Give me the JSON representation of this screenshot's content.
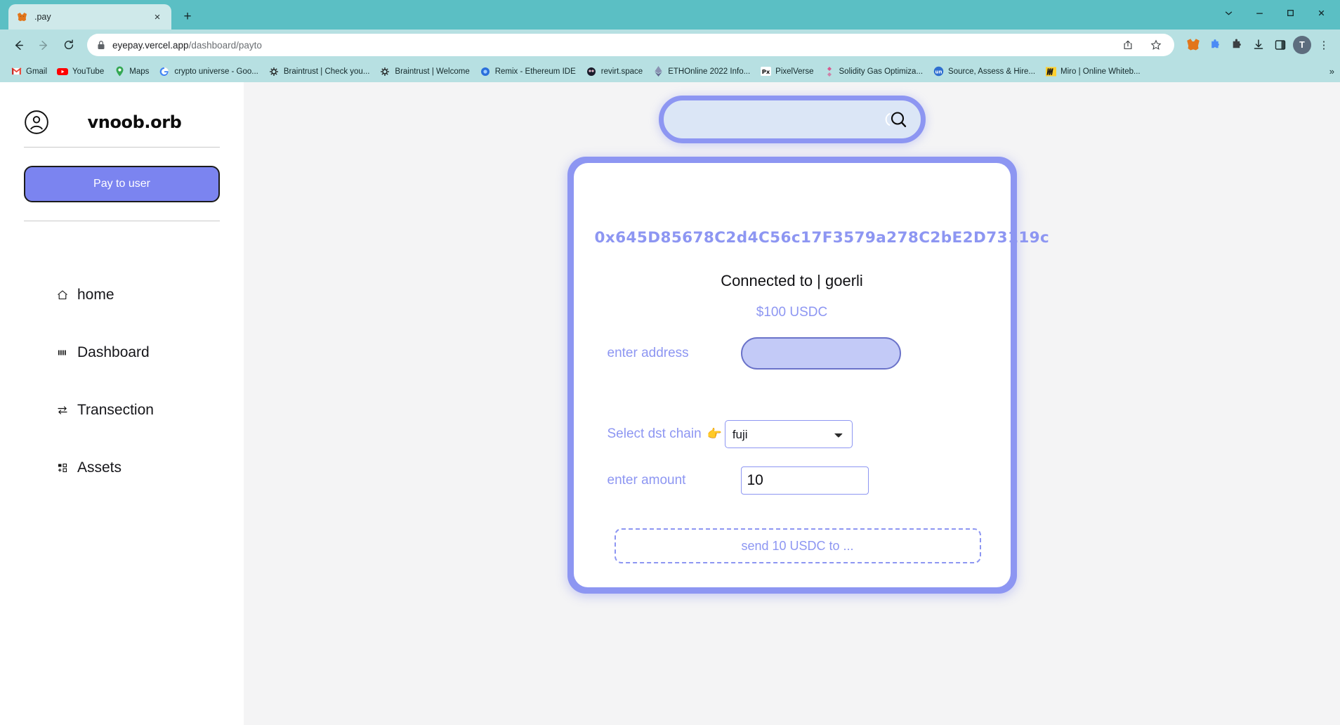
{
  "browser": {
    "tab": {
      "title": ".pay",
      "favicon": "metamask-fox-icon",
      "close": "×"
    },
    "new_tab": "+",
    "window_controls": {
      "minimize": "⌄",
      "restore": "─",
      "maximize": "□",
      "close": "✕"
    },
    "nav": {
      "back": "←",
      "forward": "→",
      "reload": "↻"
    },
    "omnibox": {
      "lock": "lock-icon",
      "url_host": "eyepay.vercel.app",
      "url_path": "/dashboard/payto",
      "url_full": "eyepay.vercel.app/dashboard/payto",
      "share": "share-icon",
      "bookmark_star": "☆"
    },
    "extensions": [
      "metamask-icon",
      "puzzle-piece-icon",
      "extensions-icon",
      "download-icon",
      "sidepanel-icon"
    ],
    "profile_initial": "T",
    "menu": "⋮",
    "bookmarks": [
      {
        "label": "Gmail",
        "icon": "gmail-icon"
      },
      {
        "label": "YouTube",
        "icon": "youtube-icon"
      },
      {
        "label": "Maps",
        "icon": "maps-icon"
      },
      {
        "label": "crypto universe - Goo...",
        "icon": "google-icon"
      },
      {
        "label": "Braintrust | Check you...",
        "icon": "braintrust-icon"
      },
      {
        "label": "Braintrust | Welcome",
        "icon": "braintrust-icon"
      },
      {
        "label": "Remix - Ethereum IDE",
        "icon": "remix-icon"
      },
      {
        "label": "revirt.space",
        "icon": "revirt-icon"
      },
      {
        "label": "ETHOnline 2022 Info...",
        "icon": "ethereum-icon"
      },
      {
        "label": "PixelVerse",
        "icon": "pixelverse-icon"
      },
      {
        "label": "Solidity Gas Optimiza...",
        "icon": "solidity-icon"
      },
      {
        "label": "Source, Assess & Hire...",
        "icon": "unstop-icon"
      },
      {
        "label": "Miro | Online Whiteb...",
        "icon": "miro-icon"
      }
    ],
    "bookmarks_overflow": "»"
  },
  "sidebar": {
    "avatar_icon": "user-circle-icon",
    "brand": "vnoob.orb",
    "pay_button": "Pay to user",
    "items": [
      {
        "label": "home",
        "icon": "home-icon",
        "glyph": "⌂"
      },
      {
        "label": "Dashboard",
        "icon": "dashboard-icon",
        "glyph": "▐▐"
      },
      {
        "label": "Transection",
        "icon": "transfer-icon",
        "glyph": "⇄"
      },
      {
        "label": "Assets",
        "icon": "assets-grid-icon",
        "glyph": "⊞"
      }
    ]
  },
  "main": {
    "search": {
      "value": "",
      "placeholder": "",
      "icon": "search-icon"
    },
    "card": {
      "wallet_address": "0x645D85678C2d4C56c17F3579a278C2bE2D73119c",
      "connected_text": "Connected to | goerli",
      "balance": "$100 USDC",
      "address_field": {
        "label": "enter address",
        "value": "",
        "placeholder": ""
      },
      "chain_field": {
        "label": "Select dst chain",
        "emoji": "👉",
        "selected": "fuji",
        "options": [
          "fuji"
        ]
      },
      "amount_field": {
        "label": "enter amount",
        "value": "10",
        "placeholder": ""
      },
      "send_button": "send 10 USDC to ..."
    }
  },
  "colors": {
    "accent": "#8d96f2",
    "accent_strong": "#7b84f0",
    "input_fill": "#c3caf7",
    "search_fill": "#dbe6f6",
    "page_bg": "#f4f4f5",
    "chrome_bg": "#b7e0e2",
    "tabstrip_bg": "#5bbfc4"
  }
}
